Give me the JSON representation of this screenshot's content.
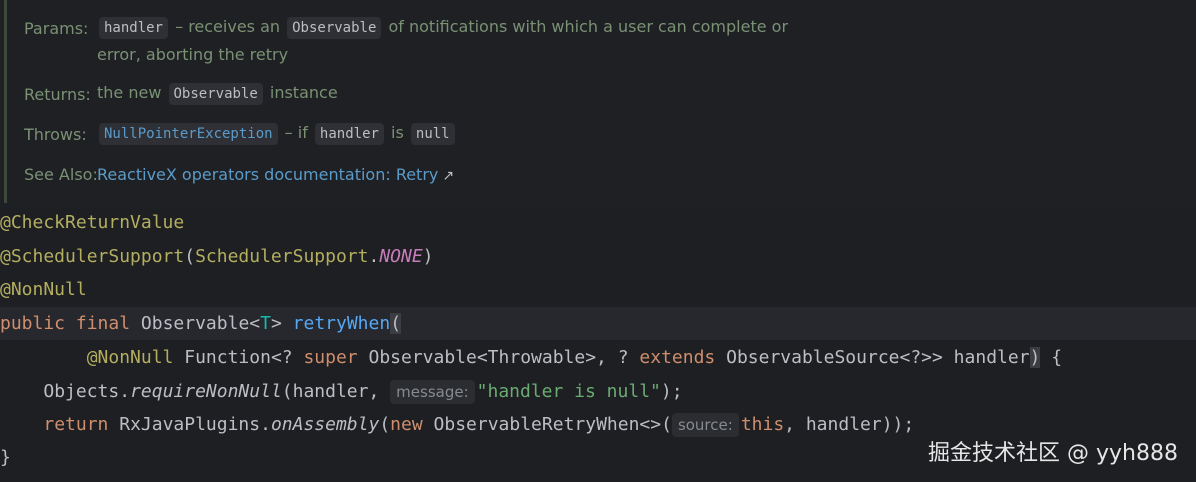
{
  "doc": {
    "params_label": "Params:",
    "params_chip_handler": "handler",
    "params_text1": " – receives an ",
    "params_chip_observable": "Observable",
    "params_text2": " of notifications with which a user can complete or",
    "params_text3": "error, aborting the retry",
    "returns_label": "Returns:",
    "returns_text1": "the new ",
    "returns_chip": "Observable",
    "returns_text2": " instance",
    "throws_label": "Throws:",
    "throws_chip_exception": "NullPointerException",
    "throws_text1": " – if ",
    "throws_chip_handler": "handler",
    "throws_text2": " is ",
    "throws_chip_null": "null",
    "seealso_label": "See Also:",
    "seealso_link": "ReactiveX operators documentation: Retry",
    "seealso_icon": "external-link-icon"
  },
  "code": {
    "l1": "@CheckReturnValue",
    "l2_ann": "@SchedulerSupport",
    "l2_open": "(",
    "l2_ann2": "SchedulerSupport",
    "l2_dot": ".",
    "l2_const": "NONE",
    "l2_close": ")",
    "l3": "@NonNull",
    "l4_public": "public",
    "l4_final": "final",
    "l4_type": "Observable<",
    "l4_T": "T",
    "l4_gt": ">",
    "l4_fn": "retryWhen",
    "l4_paren": "(",
    "l5_indent": "        ",
    "l5_ann": "@NonNull",
    "l5_a": " Function<? ",
    "l5_super": "super",
    "l5_b": " Observable<Throwable>, ? ",
    "l5_extends": "extends",
    "l5_c": " ObservableSource<?>> handler",
    "l5_paren": ")",
    "l5_brace": " {",
    "l6_indent": "    ",
    "l6_a": "Objects.",
    "l6_fn": "requireNonNull",
    "l6_b": "(handler,",
    "l6_hint": "message:",
    "l6_str": "\"handler is null\"",
    "l6_c": ");",
    "l7_indent": "    ",
    "l7_return": "return",
    "l7_a": " RxJavaPlugins.",
    "l7_fn": "onAssembly",
    "l7_b": "(",
    "l7_new": "new",
    "l7_c": " ObservableRetryWhen<>(",
    "l7_hint": "source:",
    "l7_this": "this",
    "l7_d": ", handler));",
    "l8": "}"
  },
  "watermark": "掘金技术社区 @ yyh888"
}
